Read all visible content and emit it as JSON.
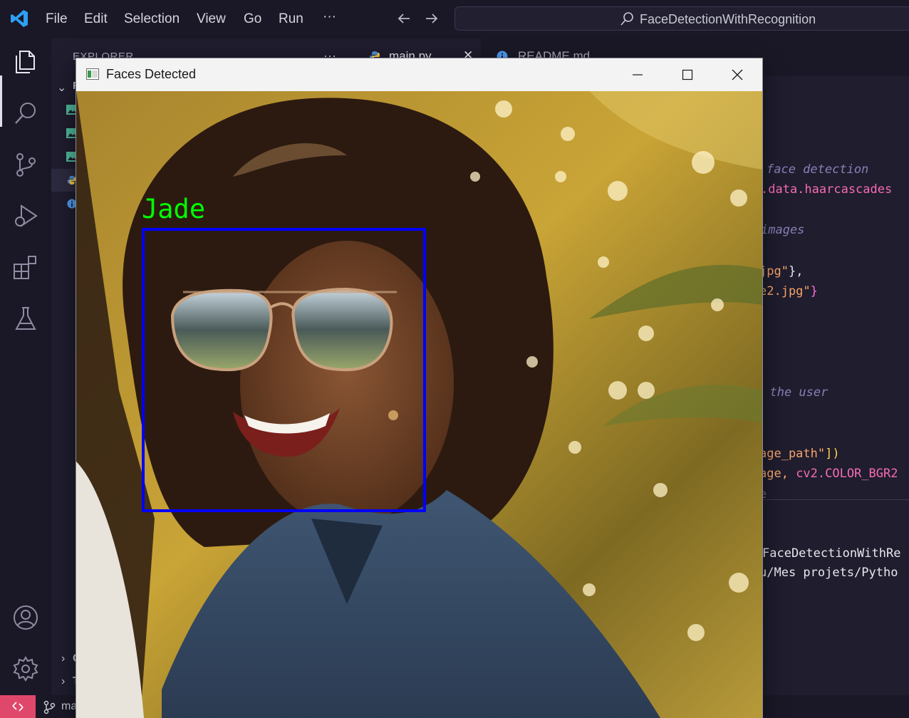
{
  "menu": [
    "File",
    "Edit",
    "Selection",
    "View",
    "Go",
    "Run"
  ],
  "more_menu": "···",
  "search": {
    "text": "FaceDetectionWithRecognition"
  },
  "explorer": {
    "title": "EXPLORER",
    "more": "···",
    "root_label": "F",
    "bottom_sections": [
      {
        "chevron": "›",
        "label": "C"
      },
      {
        "chevron": "›",
        "label": "T"
      }
    ]
  },
  "tabs": [
    {
      "label": "main.py",
      "close": "✕"
    },
    {
      "label": "README.md"
    }
  ],
  "code_lines": [
    {
      "parts": [
        {
          "t": "face detection",
          "c": "#8a7fb6",
          "i": true
        }
      ]
    },
    {
      "parts": [
        {
          "t": ".data.haarcascades",
          "c": "#f76cb4"
        }
      ]
    },
    {
      "parts": [
        {
          "t": "images",
          "c": "#8a7fb6",
          "i": true
        }
      ]
    },
    {
      "parts": [
        {
          "t": "jpg\"",
          "c": "#f7a56a"
        },
        {
          "t": "},",
          "c": "#e6e6ee"
        }
      ]
    },
    {
      "parts": [
        {
          "t": "e2.jpg\"",
          "c": "#f7a56a"
        },
        {
          "t": "}",
          "c": "#ff6bd6"
        }
      ]
    },
    {
      "parts": [
        {
          "t": "e the user",
          "c": "#8a7fb6",
          "i": true
        }
      ]
    },
    {
      "parts": [
        {
          "t": "age_path\"",
          "c": "#f7a56a"
        },
        {
          "t": "])",
          "c": "#ffd54a"
        }
      ]
    },
    {
      "parts": [
        {
          "t": "age, ",
          "c": "#f7a56a"
        },
        {
          "t": "cv2.COLOR_BGR2",
          "c": "#f76cb4"
        }
      ]
    },
    {
      "parts": [
        {
          "t": "e",
          "c": "#6e6a88"
        }
      ]
    }
  ],
  "terminal": [
    "FaceDetectionWithRe",
    "u/Mes projets/Pytho"
  ],
  "status": {
    "branch": "ma"
  },
  "window": {
    "title": "Faces Detected",
    "face_label": "Jade"
  }
}
